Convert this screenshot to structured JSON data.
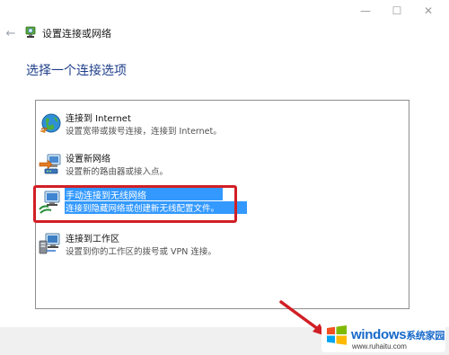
{
  "window": {
    "minimize_glyph": "—",
    "maximize_glyph": "☐",
    "close_glyph": "✕"
  },
  "nav": {
    "back_glyph": "←",
    "icon": "network-setup-icon",
    "title": "设置连接或网络"
  },
  "page": {
    "heading": "选择一个连接选项"
  },
  "options": [
    {
      "icon": "globe-connect-icon",
      "title": "连接到 Internet",
      "description": "设置宽带或拨号连接，连接到 Internet。",
      "selected": false
    },
    {
      "icon": "router-setup-icon",
      "title": "设置新网络",
      "description": "设置新的路由器或接入点。",
      "selected": false
    },
    {
      "icon": "wireless-network-icon",
      "title": "手动连接到无线网络",
      "description": "连接到隐藏网络或创建新无线配置文件。",
      "selected": true
    },
    {
      "icon": "workplace-connect-icon",
      "title": "连接到工作区",
      "description": "设置到你的工作区的拨号或 VPN 连接。",
      "selected": false
    }
  ],
  "annotation": {
    "highlight_color": "#d11f26",
    "arrow_color": "#d11f26"
  },
  "watermark": {
    "logo": "windows-logo-icon",
    "brand": "windows",
    "brand_cn": "系统家园",
    "url": "www.ruhaitu.com"
  },
  "colors": {
    "heading": "#1e3e8a",
    "selection": "#3399ff",
    "watermark_text": "#1769c9"
  }
}
